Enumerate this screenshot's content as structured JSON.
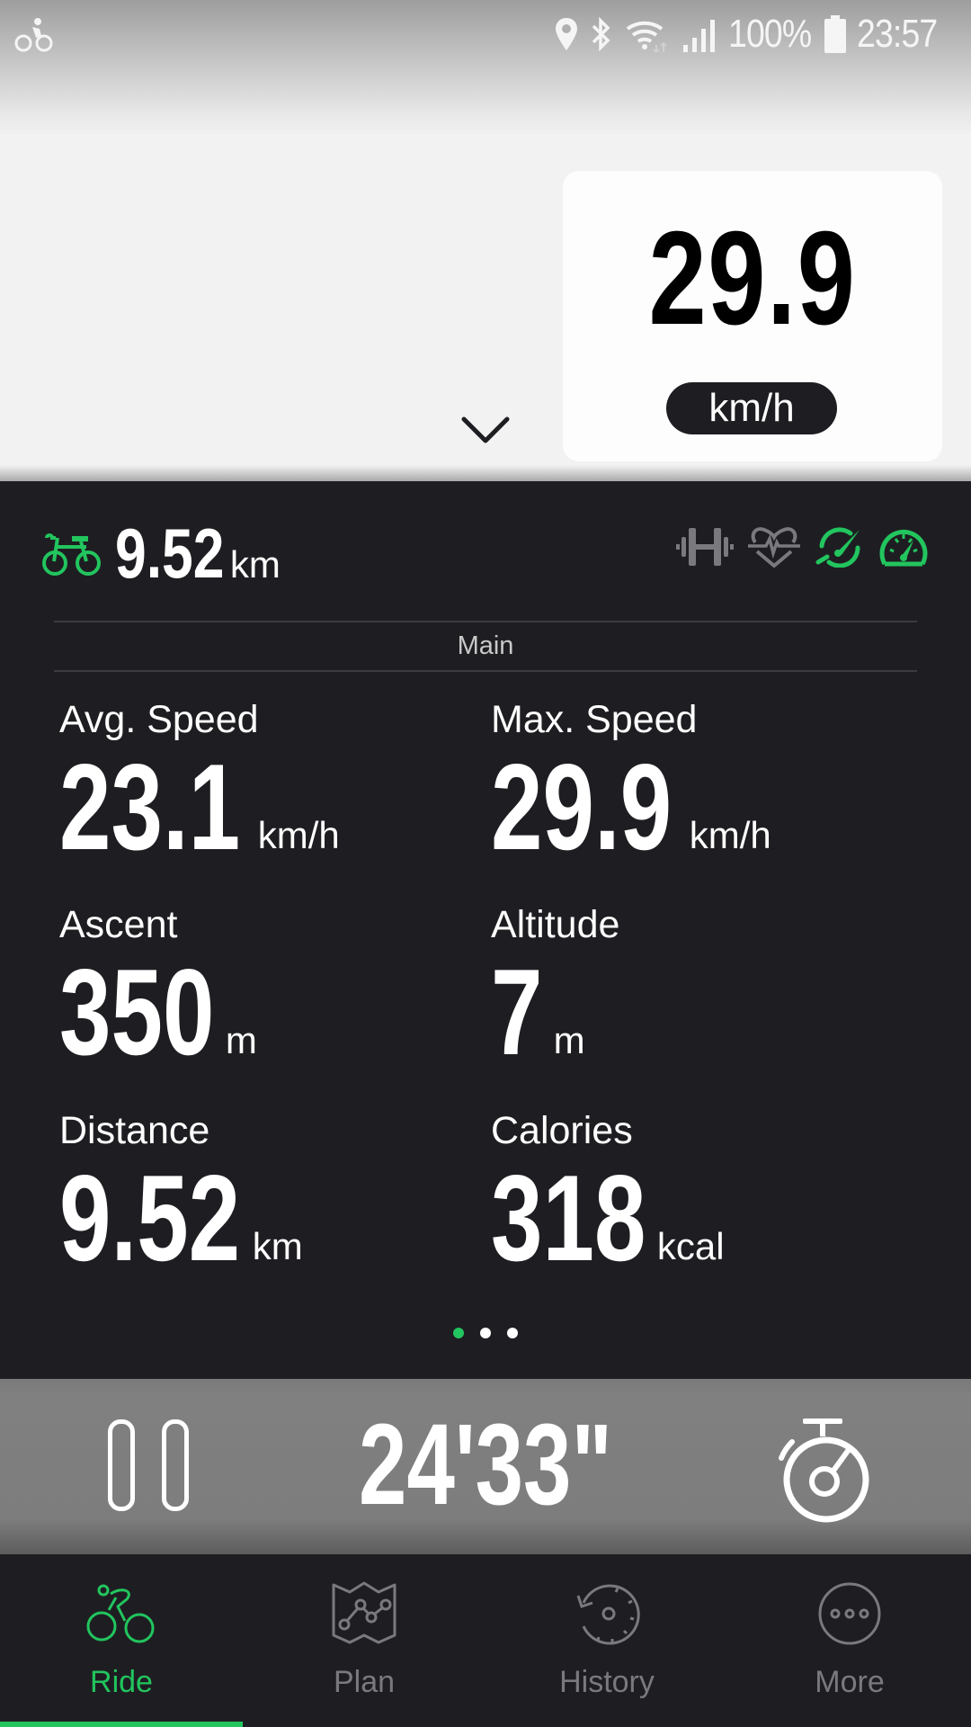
{
  "status_bar": {
    "left_icon": "cycling-notification-icon",
    "icons": [
      "location-icon",
      "bluetooth-icon",
      "wifi-icon",
      "signal-icon"
    ],
    "battery_percent": "100%",
    "battery_icon": "battery-full-icon",
    "time": "23:57"
  },
  "speed_card": {
    "value": "29.9",
    "unit": "km/h",
    "collapse_icon": "chevron-down-icon"
  },
  "ride_summary": {
    "icon": "bike-icon",
    "distance_value": "9.52",
    "distance_unit": "km",
    "sensors": [
      {
        "name": "power-sensor",
        "icon": "dumbbell-icon",
        "state": "inactive"
      },
      {
        "name": "heart-rate-sensor",
        "icon": "heart-rate-icon",
        "state": "inactive"
      },
      {
        "name": "cadence-sensor",
        "icon": "cadence-icon",
        "state": "active"
      },
      {
        "name": "speed-sensor",
        "icon": "speedometer-icon",
        "state": "active"
      }
    ]
  },
  "page": {
    "label": "Main",
    "current_page": 1,
    "total_pages": 3
  },
  "metrics": [
    {
      "label": "Avg. Speed",
      "value": "23.1",
      "unit": "km/h"
    },
    {
      "label": "Max. Speed",
      "value": "29.9",
      "unit": "km/h"
    },
    {
      "label": "Ascent",
      "value": "350",
      "unit": "m"
    },
    {
      "label": "Altitude",
      "value": "7",
      "unit": "m"
    },
    {
      "label": "Distance",
      "value": "9.52",
      "unit": "km"
    },
    {
      "label": "Calories",
      "value": "318",
      "unit": "kcal"
    }
  ],
  "timer": {
    "elapsed": "24'33\"",
    "pause_icon": "pause-icon",
    "lap_icon": "stopwatch-icon"
  },
  "bottom_nav": {
    "items": [
      {
        "label": "Ride",
        "icon": "cyclist-icon",
        "active": true
      },
      {
        "label": "Plan",
        "icon": "map-route-icon",
        "active": false
      },
      {
        "label": "History",
        "icon": "history-icon",
        "active": false
      },
      {
        "label": "More",
        "icon": "more-icon",
        "active": false
      }
    ]
  },
  "colors": {
    "accent": "#22c55e",
    "panel_bg": "#1e1e22",
    "inactive": "#7a7a7e",
    "top_bg": "#f2f2f2"
  }
}
